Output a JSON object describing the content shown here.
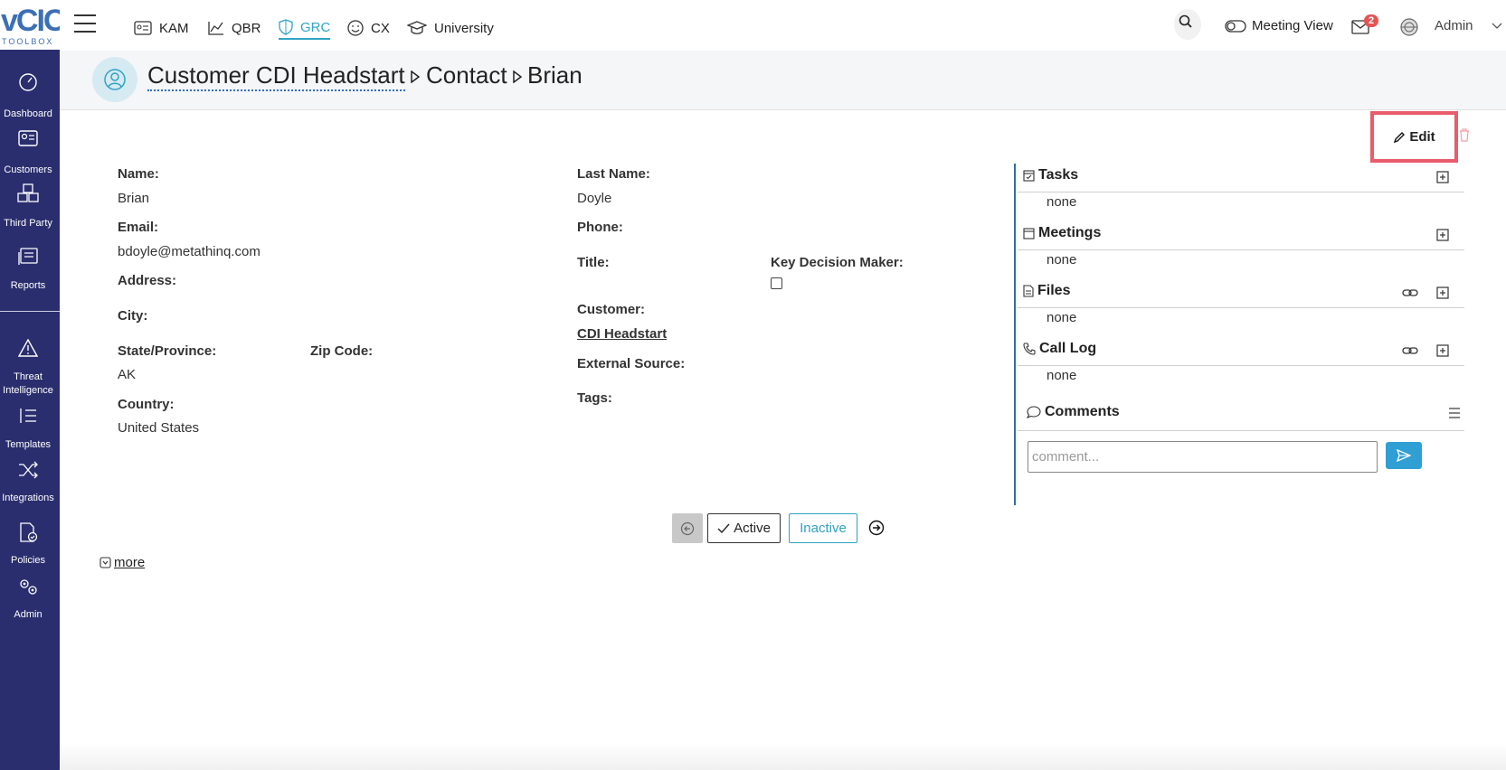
{
  "logo": {
    "big": "vCIO",
    "small": "TOOLBOX"
  },
  "sidebar": {
    "items": [
      {
        "label": "Dashboard"
      },
      {
        "label": "Customers"
      },
      {
        "label": "Third Party"
      },
      {
        "label": "Reports"
      },
      {
        "label_line1": "Threat",
        "label_line2": "Intelligence"
      },
      {
        "label": "Templates"
      },
      {
        "label": "Integrations"
      },
      {
        "label": "Policies"
      },
      {
        "label": "Admin"
      }
    ]
  },
  "topnav": {
    "tabs": [
      {
        "label": "KAM"
      },
      {
        "label": "QBR"
      },
      {
        "label": "GRC",
        "active": true
      },
      {
        "label": "CX"
      },
      {
        "label": "University"
      }
    ],
    "meeting_view": "Meeting View",
    "mail_badge": "2",
    "user": "Admin",
    "accent": "#2fa3c4"
  },
  "breadcrumb": {
    "customer": "Customer CDI Headstart",
    "section": "Contact",
    "name": "Brian"
  },
  "actions": {
    "edit_label": "Edit"
  },
  "contact": {
    "name_label": "Name:",
    "name": "Brian",
    "email_label": "Email:",
    "email": "bdoyle@metathinq.com",
    "address_label": "Address:",
    "city_label": "City:",
    "state_label": "State/Province:",
    "state": "AK",
    "zip_label": "Zip Code:",
    "country_label": "Country:",
    "country": "United States",
    "last_name_label": "Last Name:",
    "last_name": "Doyle",
    "phone_label": "Phone:",
    "title_label": "Title:",
    "key_decision_label": "Key Decision Maker:",
    "customer_label": "Customer:",
    "customer": "CDI Headstart",
    "external_source_label": "External Source:",
    "tags_label": "Tags:"
  },
  "panel": {
    "tasks": {
      "title": "Tasks",
      "value": "none"
    },
    "meetings": {
      "title": "Meetings",
      "value": "none"
    },
    "files": {
      "title": "Files",
      "value": "none"
    },
    "call_log": {
      "title": "Call Log",
      "value": "none"
    },
    "comments": {
      "title": "Comments",
      "placeholder": "comment..."
    }
  },
  "status": {
    "active_label": "Active",
    "inactive_label": "Inactive"
  },
  "more_label": "more"
}
